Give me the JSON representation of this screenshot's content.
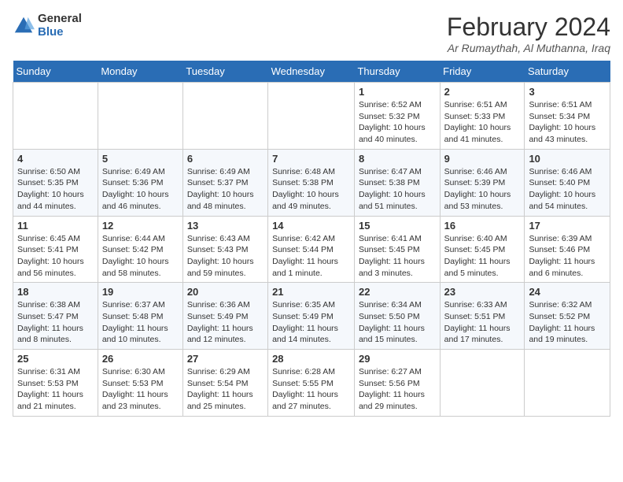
{
  "logo": {
    "general": "General",
    "blue": "Blue"
  },
  "title": "February 2024",
  "location": "Ar Rumaythah, Al Muthanna, Iraq",
  "days_of_week": [
    "Sunday",
    "Monday",
    "Tuesday",
    "Wednesday",
    "Thursday",
    "Friday",
    "Saturday"
  ],
  "weeks": [
    [
      {
        "day": "",
        "info": ""
      },
      {
        "day": "",
        "info": ""
      },
      {
        "day": "",
        "info": ""
      },
      {
        "day": "",
        "info": ""
      },
      {
        "day": "1",
        "info": "Sunrise: 6:52 AM\nSunset: 5:32 PM\nDaylight: 10 hours\nand 40 minutes."
      },
      {
        "day": "2",
        "info": "Sunrise: 6:51 AM\nSunset: 5:33 PM\nDaylight: 10 hours\nand 41 minutes."
      },
      {
        "day": "3",
        "info": "Sunrise: 6:51 AM\nSunset: 5:34 PM\nDaylight: 10 hours\nand 43 minutes."
      }
    ],
    [
      {
        "day": "4",
        "info": "Sunrise: 6:50 AM\nSunset: 5:35 PM\nDaylight: 10 hours\nand 44 minutes."
      },
      {
        "day": "5",
        "info": "Sunrise: 6:49 AM\nSunset: 5:36 PM\nDaylight: 10 hours\nand 46 minutes."
      },
      {
        "day": "6",
        "info": "Sunrise: 6:49 AM\nSunset: 5:37 PM\nDaylight: 10 hours\nand 48 minutes."
      },
      {
        "day": "7",
        "info": "Sunrise: 6:48 AM\nSunset: 5:38 PM\nDaylight: 10 hours\nand 49 minutes."
      },
      {
        "day": "8",
        "info": "Sunrise: 6:47 AM\nSunset: 5:38 PM\nDaylight: 10 hours\nand 51 minutes."
      },
      {
        "day": "9",
        "info": "Sunrise: 6:46 AM\nSunset: 5:39 PM\nDaylight: 10 hours\nand 53 minutes."
      },
      {
        "day": "10",
        "info": "Sunrise: 6:46 AM\nSunset: 5:40 PM\nDaylight: 10 hours\nand 54 minutes."
      }
    ],
    [
      {
        "day": "11",
        "info": "Sunrise: 6:45 AM\nSunset: 5:41 PM\nDaylight: 10 hours\nand 56 minutes."
      },
      {
        "day": "12",
        "info": "Sunrise: 6:44 AM\nSunset: 5:42 PM\nDaylight: 10 hours\nand 58 minutes."
      },
      {
        "day": "13",
        "info": "Sunrise: 6:43 AM\nSunset: 5:43 PM\nDaylight: 10 hours\nand 59 minutes."
      },
      {
        "day": "14",
        "info": "Sunrise: 6:42 AM\nSunset: 5:44 PM\nDaylight: 11 hours\nand 1 minute."
      },
      {
        "day": "15",
        "info": "Sunrise: 6:41 AM\nSunset: 5:45 PM\nDaylight: 11 hours\nand 3 minutes."
      },
      {
        "day": "16",
        "info": "Sunrise: 6:40 AM\nSunset: 5:45 PM\nDaylight: 11 hours\nand 5 minutes."
      },
      {
        "day": "17",
        "info": "Sunrise: 6:39 AM\nSunset: 5:46 PM\nDaylight: 11 hours\nand 6 minutes."
      }
    ],
    [
      {
        "day": "18",
        "info": "Sunrise: 6:38 AM\nSunset: 5:47 PM\nDaylight: 11 hours\nand 8 minutes."
      },
      {
        "day": "19",
        "info": "Sunrise: 6:37 AM\nSunset: 5:48 PM\nDaylight: 11 hours\nand 10 minutes."
      },
      {
        "day": "20",
        "info": "Sunrise: 6:36 AM\nSunset: 5:49 PM\nDaylight: 11 hours\nand 12 minutes."
      },
      {
        "day": "21",
        "info": "Sunrise: 6:35 AM\nSunset: 5:49 PM\nDaylight: 11 hours\nand 14 minutes."
      },
      {
        "day": "22",
        "info": "Sunrise: 6:34 AM\nSunset: 5:50 PM\nDaylight: 11 hours\nand 15 minutes."
      },
      {
        "day": "23",
        "info": "Sunrise: 6:33 AM\nSunset: 5:51 PM\nDaylight: 11 hours\nand 17 minutes."
      },
      {
        "day": "24",
        "info": "Sunrise: 6:32 AM\nSunset: 5:52 PM\nDaylight: 11 hours\nand 19 minutes."
      }
    ],
    [
      {
        "day": "25",
        "info": "Sunrise: 6:31 AM\nSunset: 5:53 PM\nDaylight: 11 hours\nand 21 minutes."
      },
      {
        "day": "26",
        "info": "Sunrise: 6:30 AM\nSunset: 5:53 PM\nDaylight: 11 hours\nand 23 minutes."
      },
      {
        "day": "27",
        "info": "Sunrise: 6:29 AM\nSunset: 5:54 PM\nDaylight: 11 hours\nand 25 minutes."
      },
      {
        "day": "28",
        "info": "Sunrise: 6:28 AM\nSunset: 5:55 PM\nDaylight: 11 hours\nand 27 minutes."
      },
      {
        "day": "29",
        "info": "Sunrise: 6:27 AM\nSunset: 5:56 PM\nDaylight: 11 hours\nand 29 minutes."
      },
      {
        "day": "",
        "info": ""
      },
      {
        "day": "",
        "info": ""
      }
    ]
  ]
}
